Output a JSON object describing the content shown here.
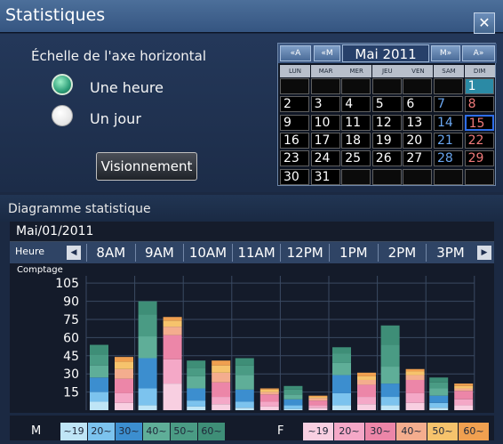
{
  "window": {
    "title": "Statistiques",
    "close_icon": "close-icon"
  },
  "scale": {
    "label": "Échelle de l'axe horizontal",
    "options": [
      {
        "label": "Une heure",
        "selected": true
      },
      {
        "label": "Un jour",
        "selected": false
      }
    ],
    "view_button": "Visionnement"
  },
  "calendar": {
    "prev_year": "«A",
    "prev_month": "«M",
    "month_label": "Mai 2011",
    "next_month": "M»",
    "next_year": "A»",
    "day_names": [
      "LUN",
      "MAR",
      "MER",
      "JEU",
      "VEN",
      "SAM",
      "DIM"
    ],
    "weeks": [
      [
        "",
        "",
        "",
        "",
        "",
        "",
        "1"
      ],
      [
        "2",
        "3",
        "4",
        "5",
        "6",
        "7",
        "8"
      ],
      [
        "9",
        "10",
        "11",
        "12",
        "13",
        "14",
        "15"
      ],
      [
        "16",
        "17",
        "18",
        "19",
        "20",
        "21",
        "22"
      ],
      [
        "23",
        "24",
        "25",
        "26",
        "27",
        "28",
        "29"
      ],
      [
        "30",
        "31",
        "",
        "",
        "",
        "",
        ""
      ]
    ],
    "selected_day": "1",
    "today_day": "15"
  },
  "diagram": {
    "section_title": "Diagramme statistique",
    "date": "Mai/01/2011",
    "hour_label": "Heure",
    "hours": [
      "8AM",
      "9AM",
      "10AM",
      "11AM",
      "12PM",
      "1PM",
      "2PM",
      "3PM"
    ],
    "y_axis_label": "Comptage"
  },
  "chart_data": {
    "type": "bar",
    "stacked": true,
    "categories": [
      "8AM",
      "9AM",
      "10AM",
      "11AM",
      "12PM",
      "1PM",
      "2PM",
      "3PM"
    ],
    "yticks": [
      15,
      30,
      45,
      60,
      75,
      90,
      105
    ],
    "ylim": [
      0,
      111
    ],
    "grid": true,
    "series": [
      {
        "group": "M",
        "age": "~19",
        "color": "#bfe5f6",
        "values": [
          7,
          4,
          3,
          2,
          1,
          4,
          4,
          2
        ]
      },
      {
        "group": "M",
        "age": "20~",
        "color": "#7cc3ee",
        "values": [
          8,
          14,
          5,
          5,
          3,
          10,
          7,
          4
        ]
      },
      {
        "group": "M",
        "age": "30~",
        "color": "#3c8ecf",
        "values": [
          12,
          25,
          10,
          10,
          5,
          15,
          11,
          6
        ]
      },
      {
        "group": "M",
        "age": "40~",
        "color": "#5fae98",
        "values": [
          10,
          18,
          10,
          12,
          4,
          10,
          14,
          6
        ]
      },
      {
        "group": "M",
        "age": "50~",
        "color": "#4a9b84",
        "values": [
          9,
          18,
          7,
          8,
          4,
          8,
          18,
          5
        ]
      },
      {
        "group": "M",
        "age": "60~",
        "color": "#3e8e77",
        "values": [
          8,
          11,
          6,
          6,
          3,
          5,
          16,
          4
        ]
      },
      {
        "group": "F",
        "age": "~19",
        "color": "#f8cfe1",
        "values": [
          6,
          22,
          5,
          3,
          2,
          5,
          6,
          4
        ]
      },
      {
        "group": "F",
        "age": "20~",
        "color": "#f4a8c7",
        "values": [
          8,
          20,
          6,
          4,
          2,
          6,
          8,
          5
        ]
      },
      {
        "group": "F",
        "age": "30~",
        "color": "#ec86a8",
        "values": [
          12,
          20,
          12,
          6,
          4,
          10,
          11,
          7
        ]
      },
      {
        "group": "F",
        "age": "40~",
        "color": "#f4ad8e",
        "values": [
          8,
          7,
          8,
          2,
          2,
          4,
          4,
          2
        ]
      },
      {
        "group": "F",
        "age": "50~",
        "color": "#f6c36c",
        "values": [
          6,
          5,
          6,
          2,
          1,
          3,
          3,
          2
        ]
      },
      {
        "group": "F",
        "age": "60~",
        "color": "#f0a050",
        "values": [
          4,
          3,
          4,
          1,
          1,
          3,
          2,
          2
        ]
      }
    ]
  },
  "legend": {
    "male_label": "M",
    "female_label": "F",
    "ages": [
      "~19",
      "20~",
      "30~",
      "40~",
      "50~",
      "60~"
    ],
    "male_colors": [
      "#bfe5f6",
      "#7cc3ee",
      "#3c8ecf",
      "#5fae98",
      "#4a9b84",
      "#3e8e77"
    ],
    "female_colors": [
      "#f8cfe1",
      "#f4a8c7",
      "#ec86a8",
      "#f4ad8e",
      "#f6c36c",
      "#f0a050"
    ]
  }
}
